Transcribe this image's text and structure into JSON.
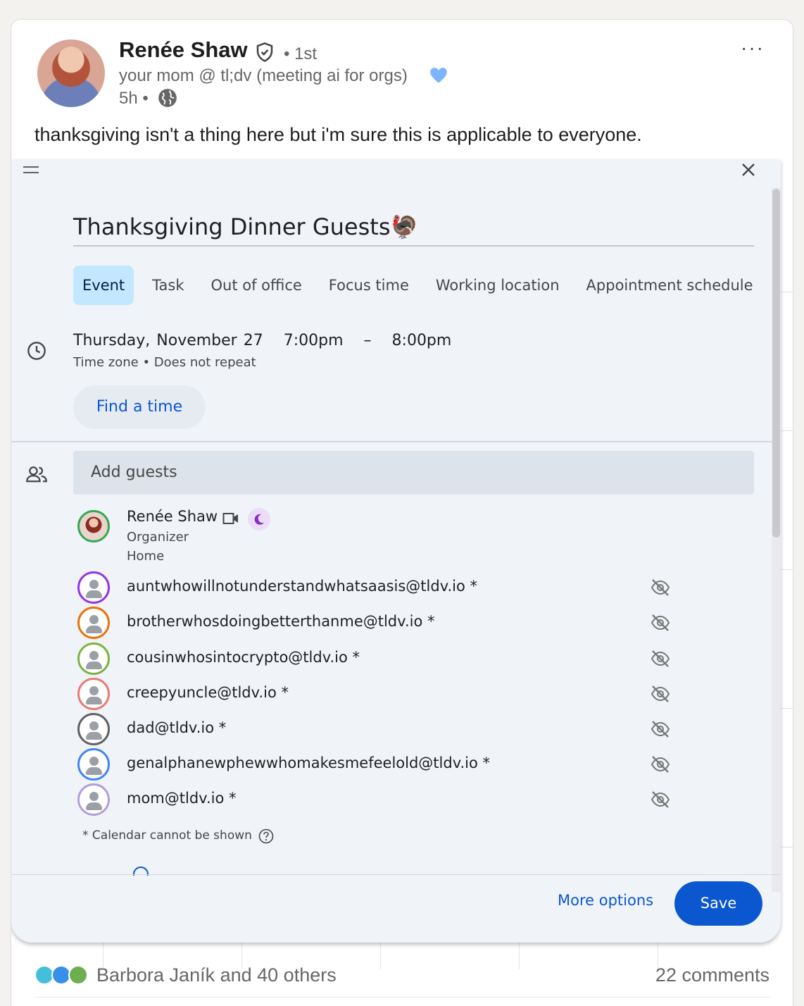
{
  "post": {
    "author_name": "Renée Shaw",
    "connection_degree": "• 1st",
    "headline": "your mom @ tl;dv (meeting ai for orgs)",
    "timestamp": "5h •",
    "body_text": "thanksgiving isn't a thing here but i'm sure this is applicable to everyone.",
    "more_menu": "···"
  },
  "calendar": {
    "title": "Thanksgiving Dinner Guests🦃",
    "tabs": [
      {
        "label": "Event",
        "active": true
      },
      {
        "label": "Task"
      },
      {
        "label": "Out of office"
      },
      {
        "label": "Focus time"
      },
      {
        "label": "Working location"
      },
      {
        "label": "Appointment schedule"
      }
    ],
    "date": "Thursday, November 27",
    "start_time": "7:00pm",
    "dash": "–",
    "end_time": "8:00pm",
    "timezone_line": "Time zone • Does not repeat",
    "find_time_label": "Find a time",
    "add_guests_placeholder": "Add guests",
    "organizer": {
      "name": "Renée Shaw",
      "role": "Organizer",
      "location": "Home"
    },
    "guests": [
      {
        "email": "auntwhowillnotunderstandwhatsaasis@tldv.io *",
        "color": "#9334e6"
      },
      {
        "email": "brotherwhosdoingbetterthanme@tldv.io *",
        "color": "#e8710a"
      },
      {
        "email": "cousinwhosintocrypto@tldv.io *",
        "color": "#7cb342"
      },
      {
        "email": "creepyuncle@tldv.io *",
        "color": "#e67c73"
      },
      {
        "email": "dad@tldv.io *",
        "color": "#616161"
      },
      {
        "email": "genalphanewphewwhomakesmefeelold@tldv.io *",
        "color": "#4285f4"
      },
      {
        "email": "mom@tldv.io *",
        "color": "#b39ddb"
      }
    ],
    "calendar_note": "* Calendar cannot be shown",
    "more_options_label": "More options",
    "save_label": "Save"
  },
  "footer": {
    "likers_text": "Barbora Janík and 40 others",
    "comments_text": "22 comments"
  },
  "colors": {
    "primary_blue": "#0b57d0",
    "tab_active_bg": "#c2e7ff",
    "dialog_bg": "#f0f4f9"
  }
}
